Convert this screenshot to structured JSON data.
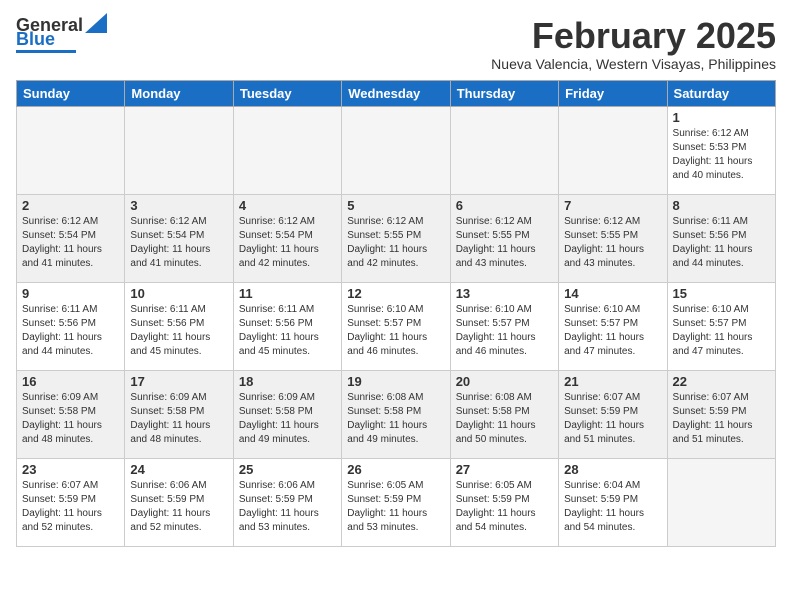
{
  "header": {
    "logo_line1": "General",
    "logo_line2": "Blue",
    "month_title": "February 2025",
    "location": "Nueva Valencia, Western Visayas, Philippines"
  },
  "weekdays": [
    "Sunday",
    "Monday",
    "Tuesday",
    "Wednesday",
    "Thursday",
    "Friday",
    "Saturday"
  ],
  "weeks": [
    [
      {
        "day": "",
        "empty": true
      },
      {
        "day": "",
        "empty": true
      },
      {
        "day": "",
        "empty": true
      },
      {
        "day": "",
        "empty": true
      },
      {
        "day": "",
        "empty": true
      },
      {
        "day": "",
        "empty": true
      },
      {
        "day": "1",
        "sunrise": "6:12 AM",
        "sunset": "5:53 PM",
        "daylight": "11 hours and 40 minutes."
      }
    ],
    [
      {
        "day": "2",
        "sunrise": "6:12 AM",
        "sunset": "5:54 PM",
        "daylight": "11 hours and 41 minutes."
      },
      {
        "day": "3",
        "sunrise": "6:12 AM",
        "sunset": "5:54 PM",
        "daylight": "11 hours and 41 minutes."
      },
      {
        "day": "4",
        "sunrise": "6:12 AM",
        "sunset": "5:54 PM",
        "daylight": "11 hours and 42 minutes."
      },
      {
        "day": "5",
        "sunrise": "6:12 AM",
        "sunset": "5:55 PM",
        "daylight": "11 hours and 42 minutes."
      },
      {
        "day": "6",
        "sunrise": "6:12 AM",
        "sunset": "5:55 PM",
        "daylight": "11 hours and 43 minutes."
      },
      {
        "day": "7",
        "sunrise": "6:12 AM",
        "sunset": "5:55 PM",
        "daylight": "11 hours and 43 minutes."
      },
      {
        "day": "8",
        "sunrise": "6:11 AM",
        "sunset": "5:56 PM",
        "daylight": "11 hours and 44 minutes."
      }
    ],
    [
      {
        "day": "9",
        "sunrise": "6:11 AM",
        "sunset": "5:56 PM",
        "daylight": "11 hours and 44 minutes."
      },
      {
        "day": "10",
        "sunrise": "6:11 AM",
        "sunset": "5:56 PM",
        "daylight": "11 hours and 45 minutes."
      },
      {
        "day": "11",
        "sunrise": "6:11 AM",
        "sunset": "5:56 PM",
        "daylight": "11 hours and 45 minutes."
      },
      {
        "day": "12",
        "sunrise": "6:10 AM",
        "sunset": "5:57 PM",
        "daylight": "11 hours and 46 minutes."
      },
      {
        "day": "13",
        "sunrise": "6:10 AM",
        "sunset": "5:57 PM",
        "daylight": "11 hours and 46 minutes."
      },
      {
        "day": "14",
        "sunrise": "6:10 AM",
        "sunset": "5:57 PM",
        "daylight": "11 hours and 47 minutes."
      },
      {
        "day": "15",
        "sunrise": "6:10 AM",
        "sunset": "5:57 PM",
        "daylight": "11 hours and 47 minutes."
      }
    ],
    [
      {
        "day": "16",
        "sunrise": "6:09 AM",
        "sunset": "5:58 PM",
        "daylight": "11 hours and 48 minutes."
      },
      {
        "day": "17",
        "sunrise": "6:09 AM",
        "sunset": "5:58 PM",
        "daylight": "11 hours and 48 minutes."
      },
      {
        "day": "18",
        "sunrise": "6:09 AM",
        "sunset": "5:58 PM",
        "daylight": "11 hours and 49 minutes."
      },
      {
        "day": "19",
        "sunrise": "6:08 AM",
        "sunset": "5:58 PM",
        "daylight": "11 hours and 49 minutes."
      },
      {
        "day": "20",
        "sunrise": "6:08 AM",
        "sunset": "5:58 PM",
        "daylight": "11 hours and 50 minutes."
      },
      {
        "day": "21",
        "sunrise": "6:07 AM",
        "sunset": "5:59 PM",
        "daylight": "11 hours and 51 minutes."
      },
      {
        "day": "22",
        "sunrise": "6:07 AM",
        "sunset": "5:59 PM",
        "daylight": "11 hours and 51 minutes."
      }
    ],
    [
      {
        "day": "23",
        "sunrise": "6:07 AM",
        "sunset": "5:59 PM",
        "daylight": "11 hours and 52 minutes."
      },
      {
        "day": "24",
        "sunrise": "6:06 AM",
        "sunset": "5:59 PM",
        "daylight": "11 hours and 52 minutes."
      },
      {
        "day": "25",
        "sunrise": "6:06 AM",
        "sunset": "5:59 PM",
        "daylight": "11 hours and 53 minutes."
      },
      {
        "day": "26",
        "sunrise": "6:05 AM",
        "sunset": "5:59 PM",
        "daylight": "11 hours and 53 minutes."
      },
      {
        "day": "27",
        "sunrise": "6:05 AM",
        "sunset": "5:59 PM",
        "daylight": "11 hours and 54 minutes."
      },
      {
        "day": "28",
        "sunrise": "6:04 AM",
        "sunset": "5:59 PM",
        "daylight": "11 hours and 54 minutes."
      },
      {
        "day": "",
        "empty": true
      }
    ]
  ]
}
